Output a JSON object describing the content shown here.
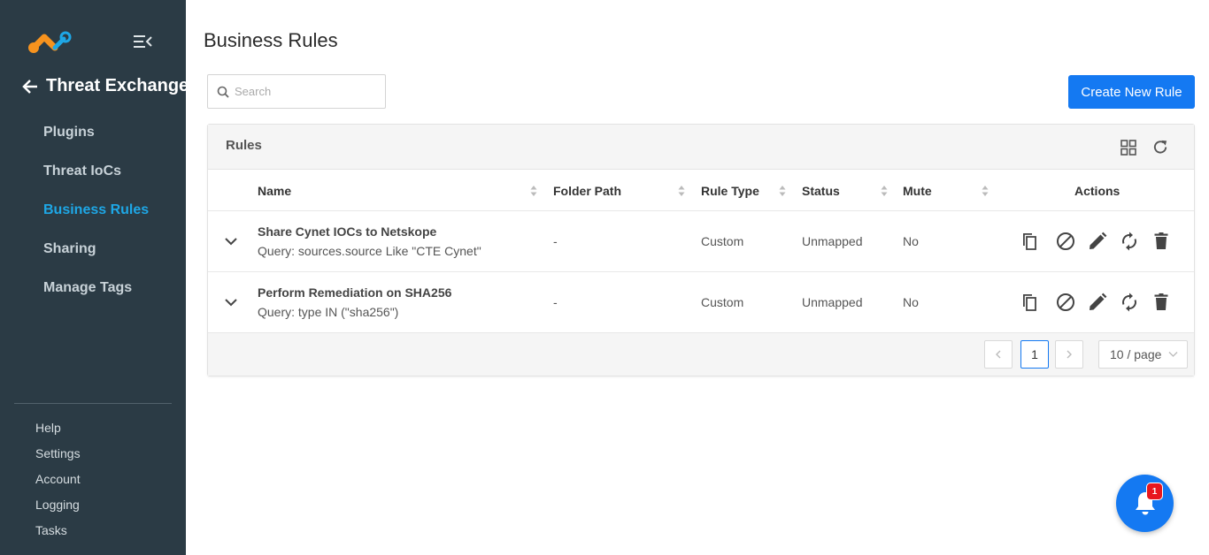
{
  "sidebar": {
    "back_title": "Threat Exchange",
    "items": [
      {
        "label": "Plugins"
      },
      {
        "label": "Threat IoCs"
      },
      {
        "label": "Business Rules"
      },
      {
        "label": "Sharing"
      },
      {
        "label": "Manage Tags"
      }
    ],
    "active_index": 2,
    "bottom_items": [
      {
        "label": "Help"
      },
      {
        "label": "Settings"
      },
      {
        "label": "Account"
      },
      {
        "label": "Logging"
      },
      {
        "label": "Tasks"
      }
    ]
  },
  "page": {
    "title": "Business Rules",
    "search_placeholder": "Search",
    "create_button": "Create New Rule"
  },
  "card": {
    "title": "Rules"
  },
  "table": {
    "columns": [
      "Name",
      "Folder Path",
      "Rule Type",
      "Status",
      "Mute",
      "Actions"
    ],
    "rows": [
      {
        "name": "Share Cynet IOCs to Netskope",
        "query": "Query: sources.source Like \"CTE Cynet\"",
        "folder_path": "-",
        "rule_type": "Custom",
        "status": "Unmapped",
        "mute": "No"
      },
      {
        "name": "Perform Remediation on SHA256",
        "query": "Query: type IN (\"sha256\")",
        "folder_path": "-",
        "rule_type": "Custom",
        "status": "Unmapped",
        "mute": "No"
      }
    ],
    "actions": [
      "copy-icon",
      "disable-icon",
      "edit-icon",
      "sync-icon",
      "delete-icon"
    ]
  },
  "pagination": {
    "current_page": "1",
    "page_size": "10 / page"
  },
  "notifications": {
    "count": "1"
  },
  "colors": {
    "sidebar_bg": "#2b3b45",
    "accent": "#1479f2",
    "active_nav": "#1ea7e6",
    "badge": "#e8171e"
  }
}
